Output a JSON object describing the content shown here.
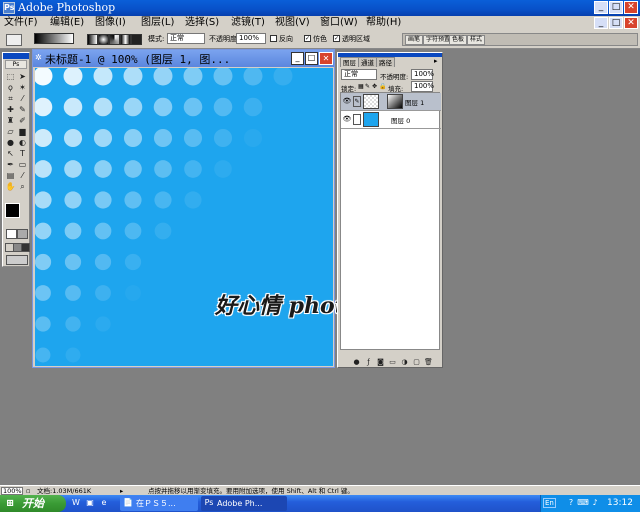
{
  "app": {
    "title": "Adobe Photoshop",
    "icon_text": "Ps"
  },
  "menu": [
    "文件(F)",
    "编辑(E)",
    "图像(I)",
    "图层(L)",
    "选择(S)",
    "滤镜(T)",
    "视图(V)",
    "窗口(W)",
    "帮助(H)"
  ],
  "options_bar": {
    "mode_label": "模式:",
    "mode_value": "正常",
    "opacity_label": "不透明度:",
    "opacity_value": "100%",
    "reverse_label": "反向",
    "dither_label": "仿色",
    "transparency_label": "透明区域",
    "tab_well": [
      "画笔",
      "字符预置",
      "色板",
      "样式"
    ]
  },
  "document": {
    "title": "未标题-1 @ 100% (图层 1, 图...",
    "canvas_color": "#1ea5ee"
  },
  "watermark": "好心情 photoshop",
  "layers_palette": {
    "tabs": [
      "图层",
      "通道",
      "路径"
    ],
    "blend_mode": "正常",
    "opacity_label": "不透明度:",
    "opacity_value": "100%",
    "lock_label": "锁定:",
    "fill_label": "填充:",
    "fill_value": "100%",
    "layers": [
      {
        "name": "图层 1",
        "selected": true
      },
      {
        "name": "图层 0",
        "selected": false
      }
    ],
    "bottom_icons": [
      "link-icon",
      "layer-style-icon",
      "mask-icon",
      "set-icon",
      "adjustment-icon",
      "new-layer-icon",
      "trash-icon"
    ]
  },
  "status": {
    "zoom": "100%",
    "doc_info": "文档:1.03M/661K",
    "hint": "点按并拖移以用渐变填充。要用附加选项，使用 Shift、Alt 和 Ctrl 键。"
  },
  "taskbar": {
    "start_label": "开始",
    "tasks": [
      {
        "label": "在ＰＳ５...",
        "active": false
      },
      {
        "label": "Adobe Ph...",
        "active": true
      }
    ],
    "lang": "En",
    "clock": "13:12"
  },
  "colors": {
    "canvas": "#1ea5ee",
    "titlebar": "#0850c8",
    "taskbar": "#245edb"
  }
}
